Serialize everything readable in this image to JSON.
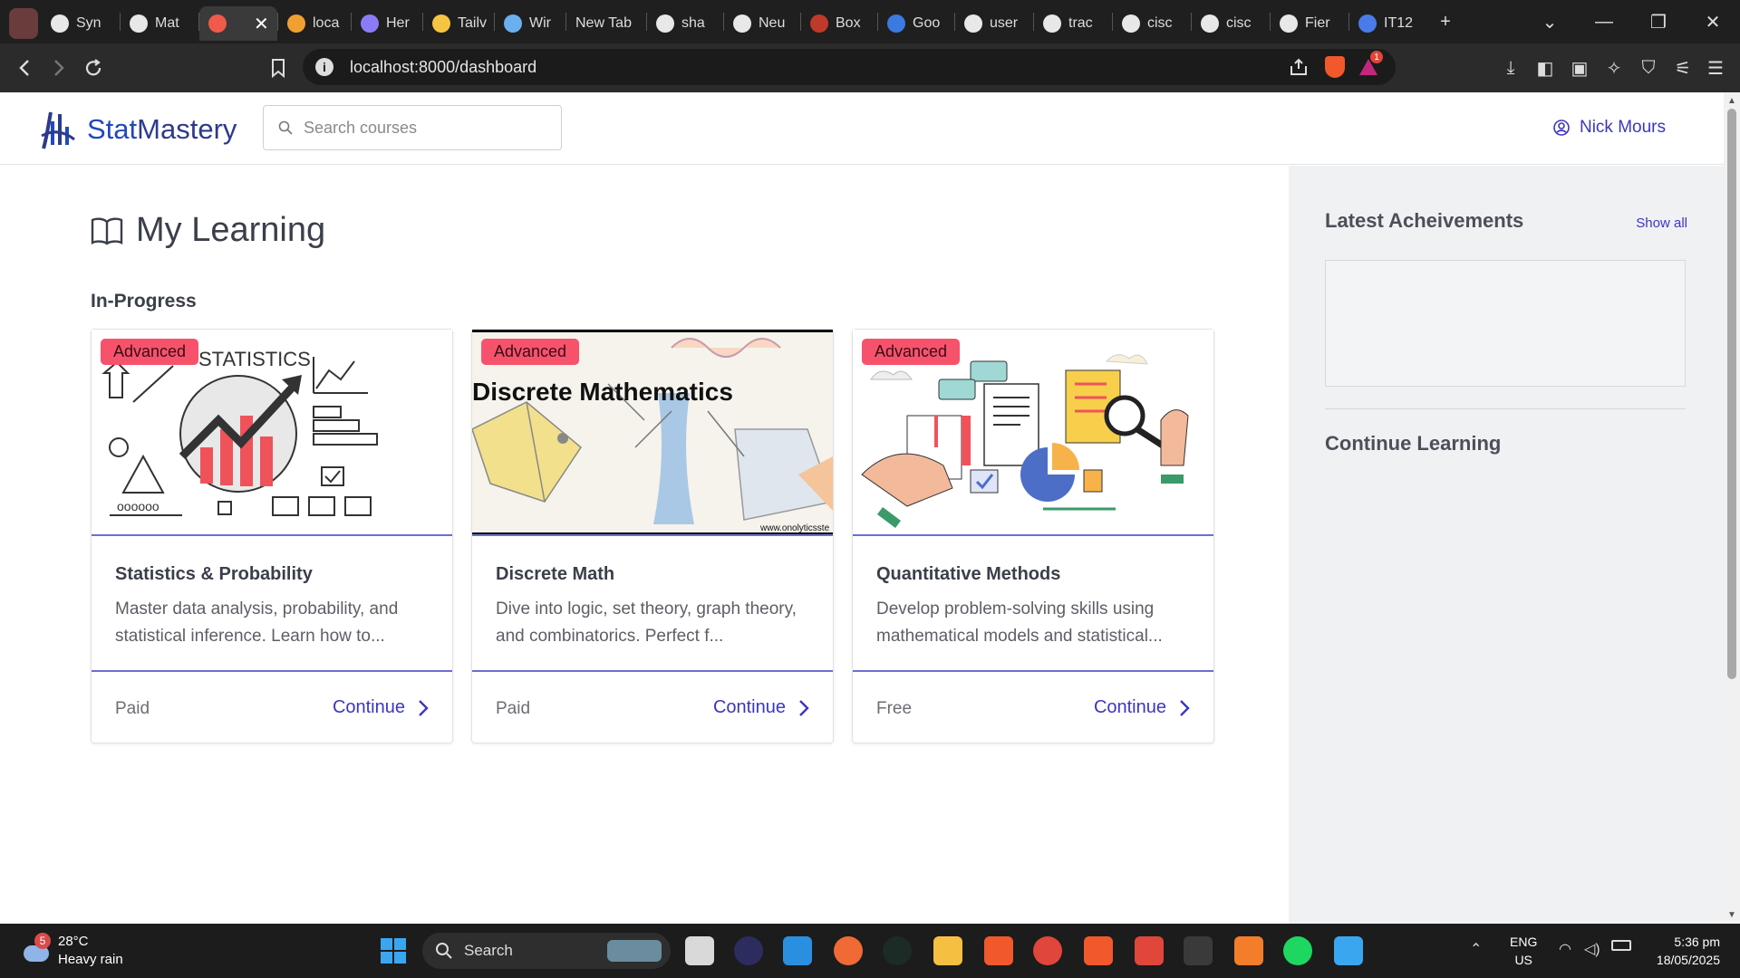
{
  "browser": {
    "tabs": [
      {
        "label": "Syn",
        "color": "#e8e8e8"
      },
      {
        "label": "Mat",
        "color": "#e8e8e8"
      },
      {
        "label": "",
        "color": "#f05a4b",
        "active": true
      },
      {
        "label": "loca",
        "color": "#f0a030"
      },
      {
        "label": "Her",
        "color": "#8b7cf6"
      },
      {
        "label": "Tailv",
        "color": "#f5c542"
      },
      {
        "label": "Wir",
        "color": "#6ab0f0"
      },
      {
        "label": "New Tab",
        "color": ""
      },
      {
        "label": "sha",
        "color": "#e8e8e8"
      },
      {
        "label": "Neu",
        "color": "#e8e8e8"
      },
      {
        "label": "Box",
        "color": "#c0392b"
      },
      {
        "label": "Goo",
        "color": "#3b7ae0"
      },
      {
        "label": "user",
        "color": "#e8e8e8"
      },
      {
        "label": "trac",
        "color": "#e8e8e8"
      },
      {
        "label": "cisc",
        "color": "#e8e8e8"
      },
      {
        "label": "cisc",
        "color": "#e8e8e8"
      },
      {
        "label": "Fier",
        "color": "#e8e8e8"
      },
      {
        "label": "IT12",
        "color": "#4a7be8"
      }
    ],
    "new_tab_symbol": "+",
    "url": "localhost:8000/dashboard",
    "notification_count": "1"
  },
  "header": {
    "brand_part1": "Stat",
    "brand_part2": "Mastery",
    "search_placeholder": "Search courses",
    "user_name": "Nick Mours"
  },
  "main": {
    "title": "My Learning",
    "section": "In-Progress",
    "courses": [
      {
        "badge": "Advanced",
        "title": "Statistics & Probability",
        "description": "Master data analysis, probability, and statistical inference. Learn how to...",
        "price": "Paid",
        "action": "Continue",
        "image_text": "STATISTICS"
      },
      {
        "badge": "Advanced",
        "title": "Discrete Math",
        "description": "Dive into logic, set theory, graph theory, and combinatorics. Perfect f...",
        "price": "Paid",
        "action": "Continue",
        "image_text": "Discrete Mathematics",
        "image_credit": "www.onolyticsste"
      },
      {
        "badge": "Advanced",
        "title": "Quantitative Methods",
        "description": "Develop problem-solving skills using mathematical models and statistical...",
        "price": "Free",
        "action": "Continue"
      }
    ]
  },
  "sidebar": {
    "achievements_title": "Latest Acheivements",
    "show_all": "Show all",
    "continue_title": "Continue Learning"
  },
  "taskbar": {
    "weather_temp": "28°C",
    "weather_desc": "Heavy rain",
    "weather_badge": "5",
    "search_label": "Search",
    "lang_line1": "ENG",
    "lang_line2": "US",
    "time": "5:36 pm",
    "date": "18/05/2025"
  }
}
